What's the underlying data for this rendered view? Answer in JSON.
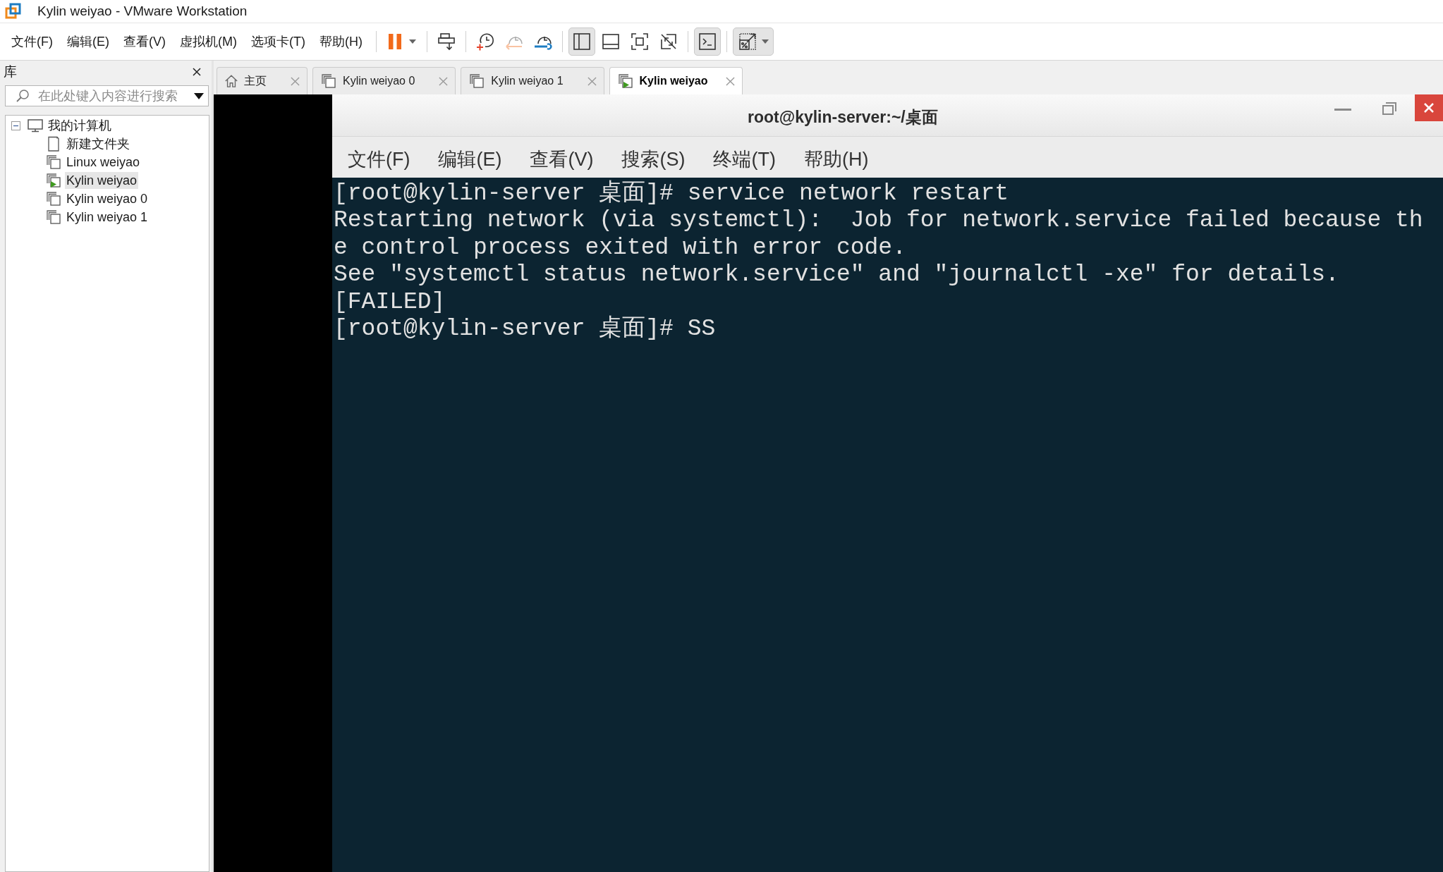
{
  "window": {
    "title": "Kylin weiyao - VMware Workstation"
  },
  "menu": [
    "文件(F)",
    "编辑(E)",
    "查看(V)",
    "虚拟机(M)",
    "选项卡(T)",
    "帮助(H)"
  ],
  "toolbar": [
    {
      "kind": "pause",
      "selected": false,
      "disabled": false,
      "dropdown": true
    },
    {
      "kind": "separator"
    },
    {
      "kind": "send-keys",
      "selected": false,
      "disabled": false,
      "dropdown": false
    },
    {
      "kind": "separator"
    },
    {
      "kind": "snapshot",
      "selected": false,
      "disabled": false,
      "dropdown": false
    },
    {
      "kind": "revert-snapshot",
      "selected": false,
      "disabled": true,
      "dropdown": false
    },
    {
      "kind": "snapshot-manager",
      "selected": false,
      "disabled": false,
      "dropdown": false
    },
    {
      "kind": "separator"
    },
    {
      "kind": "library",
      "selected": true,
      "disabled": false,
      "dropdown": false
    },
    {
      "kind": "thumbnail",
      "selected": false,
      "disabled": false,
      "dropdown": false
    },
    {
      "kind": "fullscreen",
      "selected": false,
      "disabled": false,
      "dropdown": false
    },
    {
      "kind": "unity",
      "selected": false,
      "disabled": false,
      "dropdown": false
    },
    {
      "kind": "separator"
    },
    {
      "kind": "console",
      "selected": true,
      "disabled": false,
      "dropdown": false
    },
    {
      "kind": "separator"
    },
    {
      "kind": "stretch",
      "selected": true,
      "disabled": false,
      "dropdown": true
    }
  ],
  "library": {
    "title": "库",
    "search": {
      "placeholder": "在此处键入内容进行搜索"
    },
    "tree": [
      {
        "label": "我的计算机",
        "kind": "computer",
        "expanded": true,
        "selected": false,
        "children": [
          {
            "label": "新建文件夹",
            "kind": "folder",
            "running": false,
            "selected": false
          },
          {
            "label": "Linux weiyao",
            "kind": "vm",
            "running": false,
            "selected": false
          },
          {
            "label": "Kylin weiyao",
            "kind": "vm",
            "running": true,
            "selected": true
          },
          {
            "label": "Kylin weiyao 0",
            "kind": "vm",
            "running": false,
            "selected": false
          },
          {
            "label": "Kylin weiyao 1",
            "kind": "vm",
            "running": false,
            "selected": false
          }
        ]
      }
    ]
  },
  "tabs": [
    {
      "label": "主页",
      "kind": "home",
      "running": false,
      "selected": false
    },
    {
      "label": "Kylin weiyao 0",
      "kind": "vm",
      "running": false,
      "selected": false
    },
    {
      "label": "Kylin weiyao 1",
      "kind": "vm",
      "running": false,
      "selected": false
    },
    {
      "label": "Kylin weiyao",
      "kind": "vm",
      "running": true,
      "selected": true
    }
  ],
  "guest": {
    "terminal": {
      "title": "root@kylin-server:~/桌面",
      "menu": [
        "文件(F)",
        "编辑(E)",
        "查看(V)",
        "搜索(S)",
        "终端(T)",
        "帮助(H)"
      ],
      "lines": [
        "[root@kylin-server 桌面]# service network restart",
        "Restarting network (via systemctl):  Job for network.service failed because th",
        "e control process exited with error code.",
        "See \"systemctl status network.service\" and \"journalctl -xe\" for details.",
        "[FAILED]",
        "[root@kylin-server 桌面]# SS"
      ]
    }
  }
}
